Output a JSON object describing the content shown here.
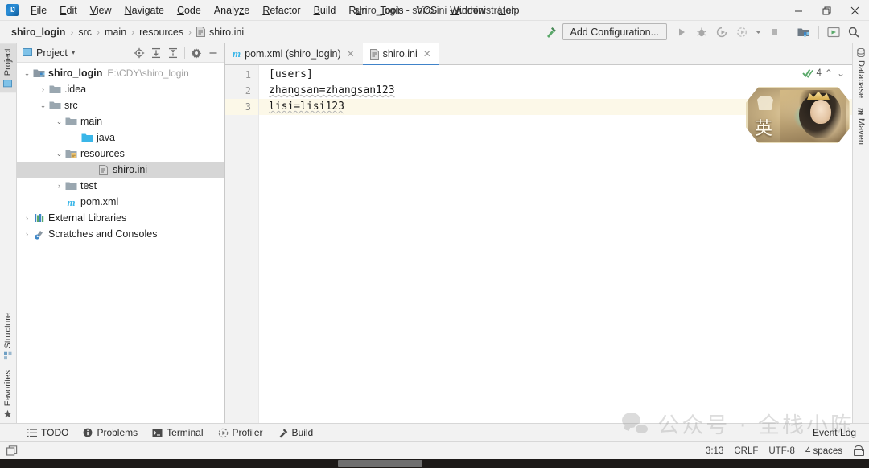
{
  "window": {
    "title": "shiro_login - shiro.ini - Administrator",
    "logo": "intellij-idea-logo",
    "minimize": "–",
    "maximize": "❐",
    "close": "✕"
  },
  "menubar": {
    "items": [
      {
        "label": "File",
        "mnemonic": "F"
      },
      {
        "label": "Edit",
        "mnemonic": "E"
      },
      {
        "label": "View",
        "mnemonic": "V"
      },
      {
        "label": "Navigate",
        "mnemonic": "N"
      },
      {
        "label": "Code",
        "mnemonic": "C"
      },
      {
        "label": "Analyze",
        "mnemonic": "z"
      },
      {
        "label": "Refactor",
        "mnemonic": "R"
      },
      {
        "label": "Build",
        "mnemonic": "B"
      },
      {
        "label": "Run",
        "mnemonic": "u"
      },
      {
        "label": "Tools",
        "mnemonic": "T"
      },
      {
        "label": "VCS",
        "mnemonic": ""
      },
      {
        "label": "Window",
        "mnemonic": "W"
      },
      {
        "label": "Help",
        "mnemonic": "H"
      }
    ]
  },
  "navbar": {
    "crumbs": [
      {
        "label": "shiro_login",
        "icon": ""
      },
      {
        "label": "src",
        "icon": ""
      },
      {
        "label": "main",
        "icon": ""
      },
      {
        "label": "resources",
        "icon": ""
      },
      {
        "label": "shiro.ini",
        "icon": "ini-file-icon"
      }
    ],
    "separator": "›",
    "add_configuration": "Add Configuration...",
    "icons": [
      "hammer-build-icon",
      "run-icon",
      "debug-icon",
      "run-coverage-icon",
      "profile-icon",
      "dropdown-arrow-icon",
      "stop-icon",
      "project-structure-icon",
      "updates-icon",
      "search-everywhere-icon"
    ]
  },
  "left_rail": {
    "top": [
      {
        "label": "Project",
        "icon": "project-icon",
        "active": true
      }
    ],
    "bottom": [
      {
        "label": "Structure",
        "icon": "structure-icon",
        "active": false
      },
      {
        "label": "Favorites",
        "icon": "star-icon",
        "active": false
      }
    ]
  },
  "right_rail": {
    "items": [
      {
        "label": "Database",
        "icon": "database-icon"
      },
      {
        "label": "Maven",
        "icon": "maven-icon"
      }
    ]
  },
  "project_panel": {
    "title": "Project",
    "dropdown": "▾",
    "tools": [
      "locate-target-icon",
      "expand-all-icon",
      "collapse-all-icon",
      "settings-gear-icon",
      "hide-panel-icon"
    ],
    "tree": [
      {
        "indent": 0,
        "arrow": "⌄",
        "icon": "module-folder-icon",
        "label": "shiro_login",
        "sub": "E:\\CDY\\shiro_login",
        "bold": true,
        "selected": false
      },
      {
        "indent": 1,
        "arrow": "›",
        "icon": "folder-icon",
        "label": ".idea",
        "sub": "",
        "bold": false,
        "selected": false
      },
      {
        "indent": 1,
        "arrow": "⌄",
        "icon": "folder-icon",
        "label": "src",
        "sub": "",
        "bold": false,
        "selected": false
      },
      {
        "indent": 2,
        "arrow": "⌄",
        "icon": "folder-icon",
        "label": "main",
        "sub": "",
        "bold": false,
        "selected": false
      },
      {
        "indent": 3,
        "arrow": "",
        "icon": "source-folder-icon",
        "label": "java",
        "sub": "",
        "bold": false,
        "selected": false
      },
      {
        "indent": 3,
        "arrow": "⌄",
        "icon": "resources-folder-icon",
        "label": "resources",
        "sub": "",
        "bold": false,
        "selected": false
      },
      {
        "indent": 4,
        "arrow": "",
        "icon": "ini-file-icon",
        "label": "shiro.ini",
        "sub": "",
        "bold": false,
        "selected": true
      },
      {
        "indent": 2,
        "arrow": "›",
        "icon": "folder-icon",
        "label": "test",
        "sub": "",
        "bold": false,
        "selected": false
      },
      {
        "indent": 2,
        "arrow": "",
        "icon": "maven-pom-icon",
        "label": "pom.xml",
        "sub": "",
        "bold": false,
        "selected": false
      },
      {
        "indent": 0,
        "arrow": "›",
        "icon": "external-libraries-icon",
        "label": "External Libraries",
        "sub": "",
        "bold": false,
        "selected": false
      },
      {
        "indent": 0,
        "arrow": "›",
        "icon": "scratches-icon",
        "label": "Scratches and Consoles",
        "sub": "",
        "bold": false,
        "selected": false
      }
    ]
  },
  "editor": {
    "tabs": [
      {
        "label": "pom.xml (shiro_login)",
        "icon": "maven-pom-icon",
        "active": false,
        "close": "✕"
      },
      {
        "label": "shiro.ini",
        "icon": "ini-file-icon",
        "active": true,
        "close": "✕"
      }
    ],
    "lines": [
      {
        "number": "1",
        "text": "[users]",
        "current": false,
        "squiggle": false
      },
      {
        "number": "2",
        "text": "zhangsan=zhangsan123",
        "current": false,
        "squiggle": true
      },
      {
        "number": "3",
        "text": "lisi=lisi123",
        "current": true,
        "squiggle": true
      }
    ],
    "inspection": {
      "icon": "inspection-ok-icon",
      "count": "4",
      "prev": "⌃",
      "next": "⌄"
    },
    "overlay_card": {
      "name": "game-character-card",
      "char": "英"
    }
  },
  "watermark": {
    "icon": "wechat-logo",
    "text": "公众号 · 全栈小陈"
  },
  "toolwindow_bar": {
    "items": [
      {
        "label": "TODO",
        "icon": "todo-icon"
      },
      {
        "label": "Problems",
        "icon": "problems-icon"
      },
      {
        "label": "Terminal",
        "icon": "terminal-icon"
      },
      {
        "label": "Profiler",
        "icon": "profiler-icon"
      },
      {
        "label": "Build",
        "icon": "build-hammer-icon"
      }
    ],
    "event_log": "Event Log"
  },
  "statusbar": {
    "position": "3:13",
    "line_separator": "CRLF",
    "encoding": "UTF-8",
    "indent": "4 spaces",
    "lock": "read-only-lock-icon"
  },
  "colors": {
    "accent_blue": "#4083c9",
    "selection_gray": "#d6d6d6",
    "panel_bg": "#f2f2f2",
    "editor_bg": "#ffffff",
    "current_line": "#fcf8e8",
    "folder_blue": "#9aa7b0",
    "source_blue": "#40b6e0"
  }
}
